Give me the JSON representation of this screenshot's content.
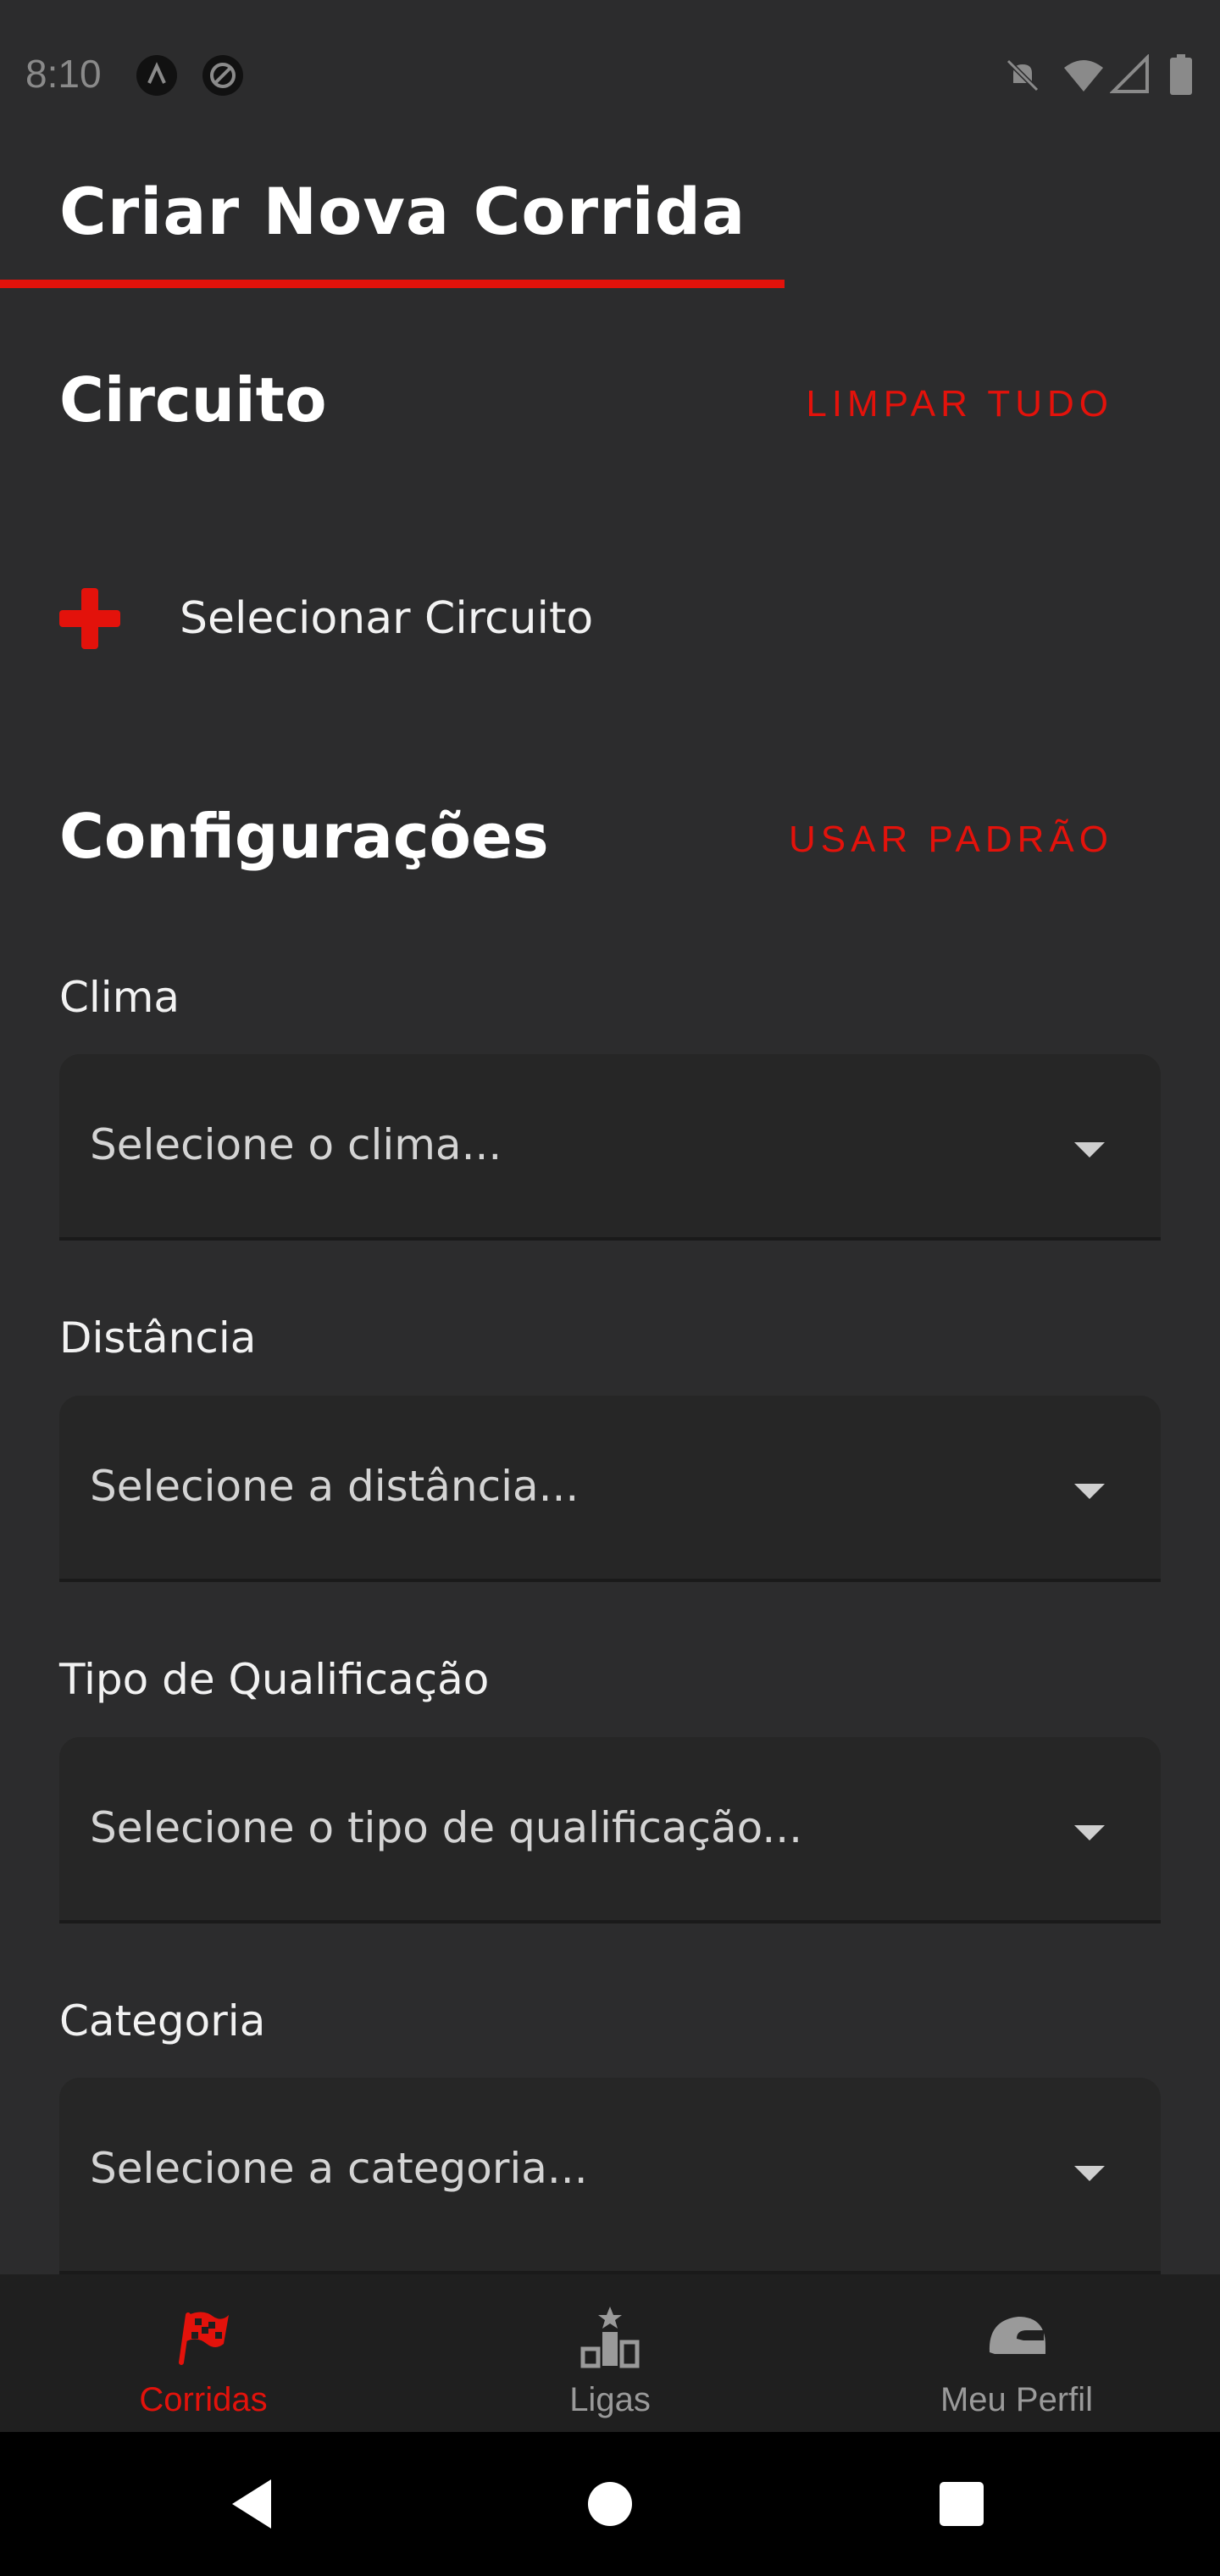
{
  "status_bar": {
    "time": "8:10",
    "icons": [
      "app-a-icon",
      "app-circle-icon",
      "dnd-off-icon",
      "wifi-icon",
      "signal-icon",
      "battery-icon"
    ]
  },
  "header": {
    "title": "Criar Nova Corrida"
  },
  "circuit_section": {
    "title": "Circuito",
    "clear_label": "LIMPAR TUDO",
    "select_label": "Selecionar Circuito"
  },
  "settings_section": {
    "title": "Configurações",
    "default_label": "USAR PADRÃO",
    "fields": [
      {
        "label": "Clima",
        "placeholder": "Selecione o clima..."
      },
      {
        "label": "Distância",
        "placeholder": "Selecione a distância..."
      },
      {
        "label": "Tipo de Qualificação",
        "placeholder": "Selecione o tipo de qualificação..."
      },
      {
        "label": "Categoria",
        "placeholder": "Selecione a categoria..."
      }
    ]
  },
  "bottom_nav": {
    "items": [
      {
        "label": "Corridas",
        "icon": "checkered-flag-icon",
        "active": true
      },
      {
        "label": "Ligas",
        "icon": "podium-icon",
        "active": false
      },
      {
        "label": "Meu Perfil",
        "icon": "helmet-icon",
        "active": false
      }
    ]
  },
  "colors": {
    "accent": "#e3120b",
    "background": "#2c2c2d",
    "field_background": "#262626",
    "nav_background": "#1f1f1f",
    "inactive": "#9a9a9a"
  }
}
